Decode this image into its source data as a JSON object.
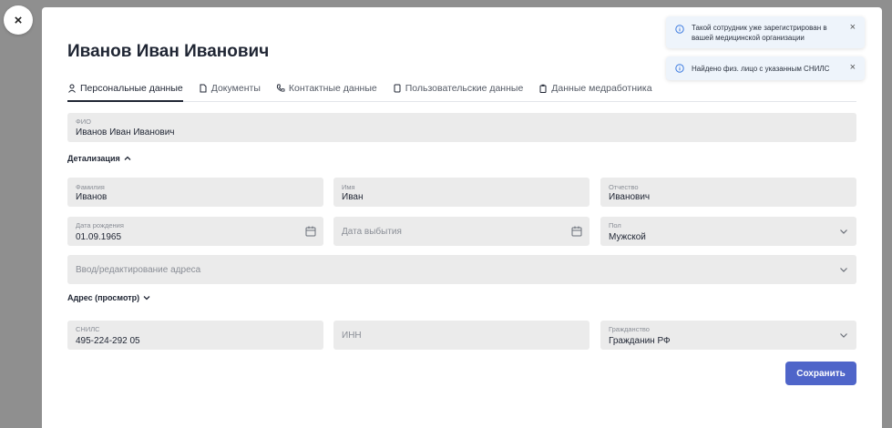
{
  "modal": {
    "close_label": "×",
    "title": "Иванов Иван Иванович"
  },
  "tabs": [
    {
      "label": "Персональные данные",
      "icon": "person-icon"
    },
    {
      "label": "Документы",
      "icon": "document-icon"
    },
    {
      "label": "Контактные данные",
      "icon": "phone-icon"
    },
    {
      "label": "Пользовательские данные",
      "icon": "user-data-icon"
    },
    {
      "label": "Данные медработника",
      "icon": "clipboard-icon"
    }
  ],
  "fio": {
    "label": "ФИО",
    "value": "Иванов Иван Иванович"
  },
  "details_section": {
    "label": "Детализация"
  },
  "last_name": {
    "label": "Фамилия",
    "value": "Иванов"
  },
  "first_name": {
    "label": "Имя",
    "value": "Иван"
  },
  "patronymic": {
    "label": "Отчество",
    "value": "Иванович"
  },
  "birth_date": {
    "label": "Дата рождения",
    "value": "01.09.1965"
  },
  "departure_date": {
    "placeholder": "Дата выбытия"
  },
  "gender": {
    "label": "Пол",
    "value": "Мужской"
  },
  "address_input": {
    "placeholder": "Ввод/редактирование адреса"
  },
  "address_view_section": {
    "label": "Адрес (просмотр)"
  },
  "snils": {
    "label": "СНИЛС",
    "value": "495-224-292 05"
  },
  "inn": {
    "placeholder": "ИНН"
  },
  "citizenship": {
    "label": "Гражданство",
    "value": "Гражданин РФ"
  },
  "save_button": {
    "label": "Сохранить"
  },
  "notifications": [
    {
      "line1": "Такой сотрудник уже зарегистрирован в",
      "line2": "вашей медицинской организации",
      "close": "×"
    },
    {
      "line1": "Найдено физ. лицо с указанным СНИЛС",
      "close": "×"
    }
  ],
  "colors": {
    "accent": "#4f65c9",
    "overlay": "#8f8f8f",
    "field_bg": "#ebebeb",
    "toast_bg": "#eef4fb",
    "info": "#3d7be0"
  }
}
